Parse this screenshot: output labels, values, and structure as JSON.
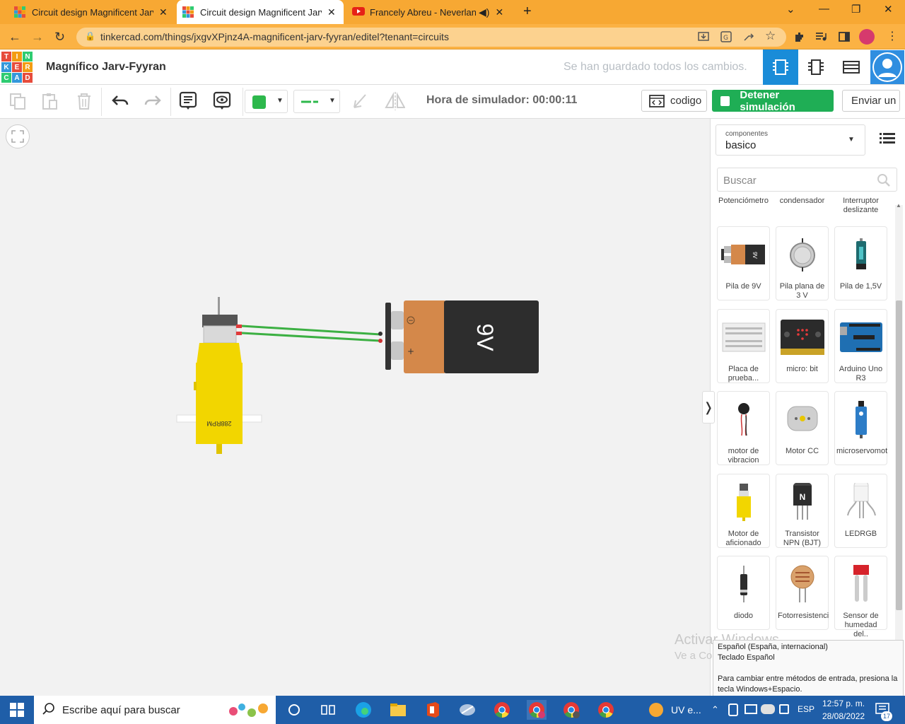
{
  "browser": {
    "tabs": [
      {
        "title": "Circuit design Magnificent Jarv-Fyyran",
        "active": false
      },
      {
        "title": "Circuit design Magnificent Jarv-Fyyran",
        "active": true
      },
      {
        "title": "Francely Abreu - Neverland",
        "active": false
      }
    ],
    "url": "tinkercad.com/things/jxgvXPjnz4A-magnificent-jarv-fyyran/editel?tenant=circuits"
  },
  "header": {
    "logo": [
      "T",
      "I",
      "N",
      "K",
      "E",
      "R",
      "C",
      "A",
      "D"
    ],
    "title": "Magnífico Jarv-Fyyran",
    "save_status": "Se han guardado todos los cambios."
  },
  "toolbar": {
    "sim_time": "Hora de simulador: 00:00:11",
    "code_label": "codigo",
    "stop_label": "Detener simulación",
    "send_label": "Enviar un",
    "color": "#2db84c"
  },
  "canvas": {
    "motor_label": "288RPM",
    "battery_label": "9V",
    "battery_minus": "−",
    "battery_plus": "+"
  },
  "panel": {
    "components_label": "componentes",
    "components_value": "basico",
    "search_placeholder": "Buscar",
    "partial_row": [
      "Potenciómetro",
      "condensador",
      "Interruptor deslizante"
    ],
    "items": [
      {
        "label": "Pila de 9V",
        "icon": "9v-battery-icon"
      },
      {
        "label": "Pila plana de 3 V",
        "icon": "coin-cell-icon"
      },
      {
        "label": "Pila de 1,5V",
        "icon": "aa-battery-icon"
      },
      {
        "label": "Placa de prueba...",
        "icon": "breadboard-icon"
      },
      {
        "label": "micro: bit",
        "icon": "microbit-icon"
      },
      {
        "label": "Arduino Uno R3",
        "icon": "arduino-icon"
      },
      {
        "label": "motor de vibracion",
        "icon": "vibration-motor-icon"
      },
      {
        "label": "Motor CC",
        "icon": "dc-motor-icon"
      },
      {
        "label": "microservomot",
        "icon": "servo-icon"
      },
      {
        "label": "Motor de aficionado",
        "icon": "hobby-motor-icon"
      },
      {
        "label": "Transistor NPN (BJT)",
        "icon": "transistor-icon"
      },
      {
        "label": "LEDRGB",
        "icon": "rgb-led-icon"
      },
      {
        "label": "diodo",
        "icon": "diode-icon"
      },
      {
        "label": "Fotorresistenci",
        "icon": "photoresistor-icon"
      },
      {
        "label": "Sensor de humedad del..",
        "icon": "moisture-sensor-icon"
      }
    ],
    "transistor_letter": "N",
    "battery_letter": "9V"
  },
  "watermark": {
    "line1": "Activar Windows",
    "line2": "Ve a Configuración para activar Windows."
  },
  "ime_tooltip": {
    "line1": "Español (España, internacional)",
    "line2": "Teclado Español",
    "line3": "Para cambiar entre métodos de entrada, presiona la tecla Windows+Espacio."
  },
  "taskbar": {
    "search_placeholder": "Escribe aquí para buscar",
    "uv_label": "UV e...",
    "lang": "ESP",
    "time": "12:57 p. m.",
    "date": "28/08/2022",
    "notif_count": "17"
  }
}
